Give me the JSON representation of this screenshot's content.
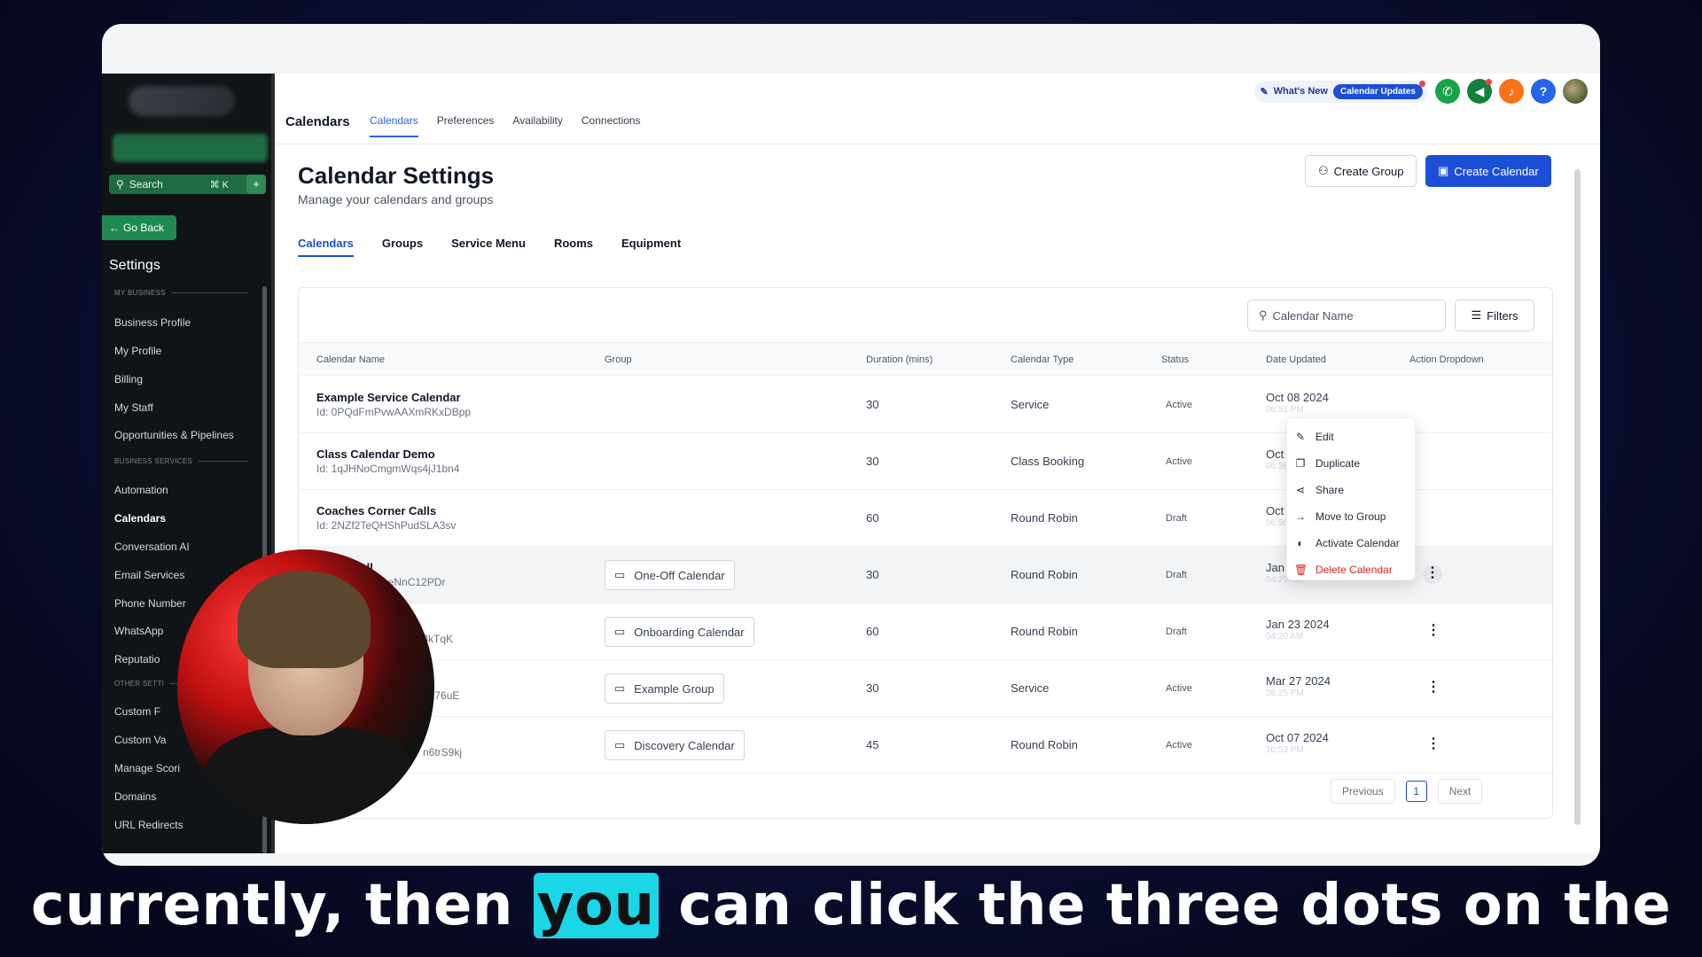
{
  "sidebar": {
    "search_placeholder": "Search",
    "search_kbd": "⌘ K",
    "add_label": "+",
    "go_back": "Go Back",
    "title": "Settings",
    "section_my_business": "MY BUSINESS",
    "section_business_services": "BUSINESS SERVICES",
    "section_other_settings": "OTHER SETTI",
    "items": [
      {
        "label": "Business Profile"
      },
      {
        "label": "My Profile"
      },
      {
        "label": "Billing"
      },
      {
        "label": "My Staff"
      },
      {
        "label": "Opportunities & Pipelines"
      },
      {
        "label": "Automation"
      },
      {
        "label": "Calendars"
      },
      {
        "label": "Conversation AI"
      },
      {
        "label": "Email Services"
      },
      {
        "label": "Phone Number"
      },
      {
        "label": "WhatsApp"
      },
      {
        "label": "Reputatio"
      },
      {
        "label": "Custom F"
      },
      {
        "label": "Custom Va"
      },
      {
        "label": "Manage Scori"
      },
      {
        "label": "Domains"
      },
      {
        "label": "URL Redirects"
      }
    ]
  },
  "topbar": {
    "title": "Calendars",
    "tabs": [
      {
        "label": "Calendars"
      },
      {
        "label": "Preferences"
      },
      {
        "label": "Availability"
      },
      {
        "label": "Connections"
      }
    ],
    "whats_new": "What's New",
    "calendar_updates": "Calendar Updates",
    "help": "?"
  },
  "page": {
    "title": "Calendar Settings",
    "subtitle": "Manage your calendars and groups",
    "create_group": "Create Group",
    "create_calendar": "Create Calendar",
    "sub_tabs": [
      {
        "label": "Calendars"
      },
      {
        "label": "Groups"
      },
      {
        "label": "Service Menu"
      },
      {
        "label": "Rooms"
      },
      {
        "label": "Equipment"
      }
    ],
    "search_placeholder": "Calendar Name",
    "filters": "Filters"
  },
  "table": {
    "headers": {
      "name": "Calendar Name",
      "group": "Group",
      "duration": "Duration (mins)",
      "type": "Calendar Type",
      "status": "Status",
      "date": "Date Updated",
      "action": "Action Dropdown"
    },
    "rows": [
      {
        "name": "Example Service Calendar",
        "id": "Id: 0PQdFmPvwAAXmRKxDBpp",
        "group": "",
        "duration": "30",
        "type": "Service",
        "status": "Active",
        "date": "Oct 08 2024",
        "time": "06:51 PM"
      },
      {
        "name": "Class Calendar Demo",
        "id": "Id: 1qJHNoCmgmWqs4jJ1bn4",
        "group": "",
        "duration": "30",
        "type": "Class Booking",
        "status": "Active",
        "date": "Oct 08 2024",
        "time": "06:38 PM"
      },
      {
        "name": "Coaches Corner Calls",
        "id": "Id: 2NZf2TeQHShPudSLA3sv",
        "group": "",
        "duration": "60",
        "type": "Round Robin",
        "status": "Draft",
        "date": "Oct 08 2024",
        "time": "06:50 PM"
      },
      {
        "name": "Call",
        "id": "3ltAeNnC12PDr",
        "group": "One-Off Calendar",
        "duration": "30",
        "type": "Round Robin",
        "status": "Draft",
        "date": "Jan 23 2024",
        "time": "04:20 AM"
      },
      {
        "name": "",
        "id": "ln3kTqK",
        "group": "Onboarding Calendar",
        "duration": "60",
        "type": "Round Robin",
        "status": "Draft",
        "date": "Jan 23 2024",
        "time": "04:20 AM"
      },
      {
        "name": "g",
        "id": "N276uE",
        "group": "Example Group",
        "duration": "30",
        "type": "Service",
        "status": "Active",
        "date": "Mar 27 2024",
        "time": "08:25 PM"
      },
      {
        "name": "",
        "id": "n6trS9kj",
        "group": "Discovery Calendar",
        "duration": "45",
        "type": "Round Robin",
        "status": "Active",
        "date": "Oct 07 2024",
        "time": "10:53 PM"
      }
    ]
  },
  "dropdown": {
    "items": [
      {
        "label": "Edit",
        "icon": "pencil-icon"
      },
      {
        "label": "Duplicate",
        "icon": "copy-icon"
      },
      {
        "label": "Share",
        "icon": "share-icon"
      },
      {
        "label": "Move to Group",
        "icon": "arrow-right-icon"
      },
      {
        "label": "Activate Calendar",
        "icon": "toggle-icon"
      },
      {
        "label": "Delete Calendar",
        "icon": "trash-icon"
      }
    ]
  },
  "pagination": {
    "previous": "Previous",
    "page": "1",
    "next": "Next"
  },
  "caption": {
    "before": "currently, then ",
    "highlight": "you",
    "after": " can click the three dots on the"
  },
  "colors": {
    "accent": "#1d4ed8",
    "sidebar_bg": "#111417",
    "go_back": "#1f8a4f",
    "danger": "#dc2626",
    "caption_highlight": "#1ad6e6"
  }
}
